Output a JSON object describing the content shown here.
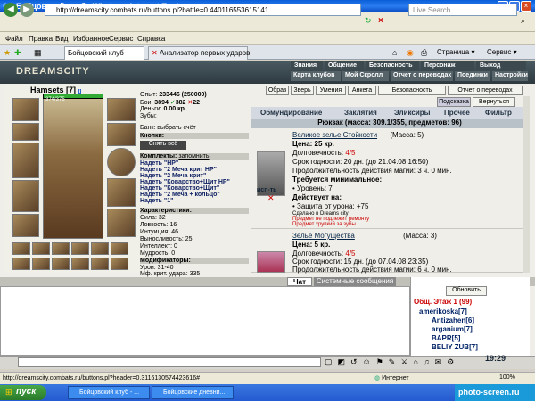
{
  "window": {
    "title": "Бойцовский клуб - Windows Internet Explorer"
  },
  "address": {
    "url": "http://dreamscity.combats.ru/buttons.pl?battle=0.440116553615141",
    "search_placeholder": "Live Search"
  },
  "menu": [
    "Файл",
    "Правка",
    "Вид",
    "Избранное",
    "Сервис",
    "Справка"
  ],
  "tabs": [
    "Бойцовский клуб",
    "Анализатор первых ударов"
  ],
  "toolbar": {
    "page": "Страница",
    "tools": "Сервис"
  },
  "game": {
    "logo": "DREAMSCITY",
    "nav1": [
      "Знания",
      "Общение",
      "Безопасность",
      "Персонаж",
      "Выход"
    ],
    "nav2": [
      "Карта клубов",
      "Мой Скролл",
      "Отчет о переводах",
      "Поединки",
      "Настройки"
    ],
    "char": {
      "name": "Hamsets",
      "level": "[7]",
      "hp": "374/375"
    },
    "stats": {
      "exp_label": "Опыт:",
      "exp": "233446 (250000)",
      "battles_label": "Бои:",
      "battles": "3894",
      "wins": "382",
      "losses": "22",
      "money_label": "Деньги:",
      "money": "0.00 кр.",
      "teeth_label": "Зубы:",
      "bank": "Банк: выбрать счёт",
      "buttons_hdr": "Кнопки:",
      "remove_all": "Снять всё",
      "sets_hdr": "Комплекты:",
      "remember": "запомнить",
      "sets": [
        "Надеть \"HP\"",
        "Надеть \"2 Меча крит HP\"",
        "Надеть \"2 Меча крит\"",
        "Надеть \"Коварство+Щит HP\"",
        "Надеть \"Коварство+Щит\"",
        "Надеть \"2 Меча + кольцо\"",
        "Надеть \"1\""
      ],
      "chars_hdr": "Характеристики:",
      "strength": "Сила: 32",
      "agility": "Ловкость: 16",
      "intuition": "Интуиция: 46",
      "endurance": "Выносливость: 25",
      "intellect": "Интеллект: 0",
      "wisdom": "Мудрость: 0",
      "mods_hdr": "Модификаторы:",
      "damage": "Урон: 31-40",
      "crit": "Мф. крит. удара: 335"
    },
    "rbtns": [
      "Образ",
      "Зверь",
      "Умения",
      "Анкета",
      "Безопасность",
      "Отчет о переводах"
    ],
    "rbtns2": [
      "Подсказка",
      "Вернуться"
    ],
    "invtabs": [
      "Обмундирование",
      "Заклятия",
      "Эликсиры",
      "Прочее",
      "Фильтр"
    ],
    "mass": "Рюкзак (масса: 309.1/355, предметов: 96)",
    "items": [
      {
        "name": "Великое зелье Стойкости",
        "mass": "(Масса: 5)",
        "price": "Цена: 25 кр.",
        "dur_label": "Долговечность:",
        "dur": "4/5",
        "expiry": "Срок годности: 20 дн. (до 21.04.08 16:50)",
        "duration": "Продолжительность действия магии: 3 ч. 0 мин.",
        "req": "Требуется минимальное:",
        "req1": "• Уровень: 7",
        "acts": "Действует на:",
        "act1": "• Защита от урона: +75",
        "made": "Сделано в Dreams city",
        "note1": "Предмет не подлежит ремонту",
        "note2": "Предмет хрупкий за зубы",
        "use": "исп-ть"
      },
      {
        "name": "Зелье Могущества",
        "mass": "(Масса: 3)",
        "price": "Цена: 5 кр.",
        "dur_label": "Долговечность:",
        "dur": "4/5",
        "expiry": "Срок годности: 15 дн. (до 07.04.08 23:35)",
        "duration": "Продолжительность действия магии: 6 ч. 0 мин."
      }
    ],
    "chat_tabs": [
      "Чат",
      "Системные сообщения"
    ],
    "refresh": "Обновить",
    "room": "Общ. Этаж 1 (99)",
    "users": [
      {
        "n": "amerikoska",
        "l": "[7]"
      },
      {
        "n": "Antizahen",
        "l": "[6]"
      },
      {
        "n": "arganium",
        "l": "[7]"
      },
      {
        "n": "BAPR",
        "l": "[5]"
      },
      {
        "n": "BELIY ZUB",
        "l": "[7]"
      }
    ],
    "time": "19:29"
  },
  "status": {
    "url": "http://dreamscity.combats.ru/buttons.pl?header=0.3116130574423616#",
    "zone": "Интернет",
    "zoom": "100%"
  },
  "taskbar": {
    "start": "пуск",
    "tasks": [
      "Бойцовский клуб - ...",
      "Бойцовские дневни..."
    ],
    "watermark": "photo-screen.ru"
  }
}
